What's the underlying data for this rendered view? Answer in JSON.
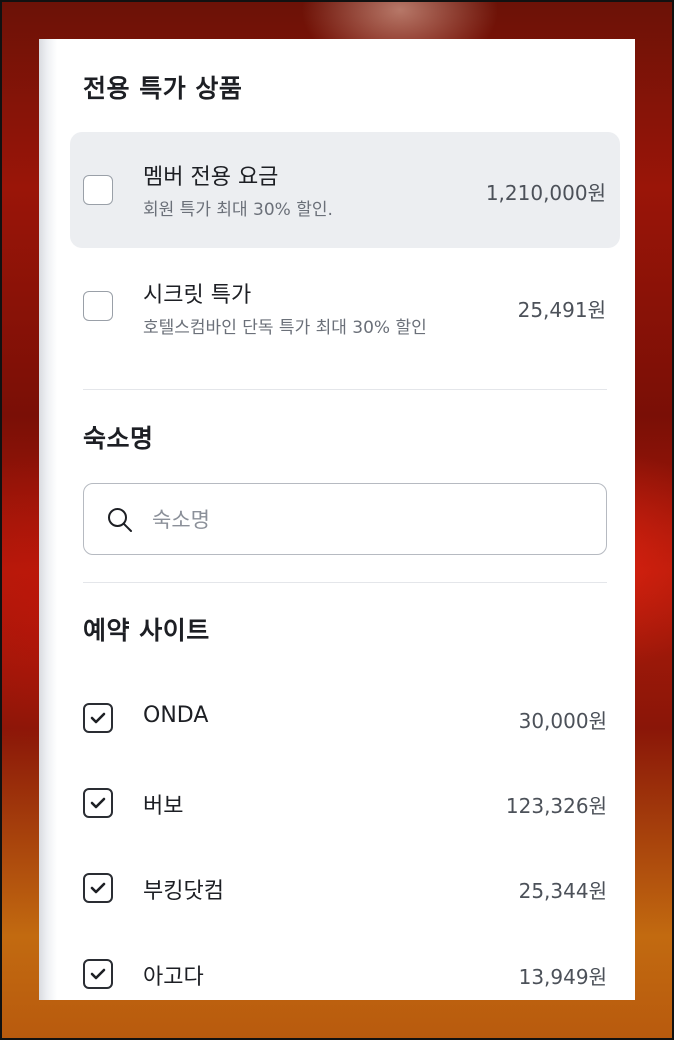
{
  "special_rates": {
    "title": "전용 특가 상품",
    "items": [
      {
        "name": "멤버 전용 요금",
        "desc": "회원 특가 최대 30% 할인.",
        "price": "1,210,000원",
        "checked": false
      },
      {
        "name": "시크릿 특가",
        "desc": "호텔스컴바인 단독 특가 최대 30% 할인",
        "price": "25,491원",
        "checked": false
      }
    ]
  },
  "property_name": {
    "title": "숙소명",
    "search_placeholder": "숙소명",
    "search_value": ""
  },
  "booking_sites": {
    "title": "예약 사이트",
    "items": [
      {
        "name": "ONDA",
        "price": "30,000원",
        "checked": true
      },
      {
        "name": "버보",
        "price": "123,326원",
        "checked": true
      },
      {
        "name": "부킹닷컴",
        "price": "25,344원",
        "checked": true
      },
      {
        "name": "아고다",
        "price": "13,949원",
        "checked": true
      }
    ]
  },
  "icons": {
    "search": "search-icon",
    "check": "check-icon"
  },
  "colors": {
    "highlight_row": "#eceef1",
    "text_primary": "#1d1f24",
    "text_secondary": "#6b7079"
  }
}
